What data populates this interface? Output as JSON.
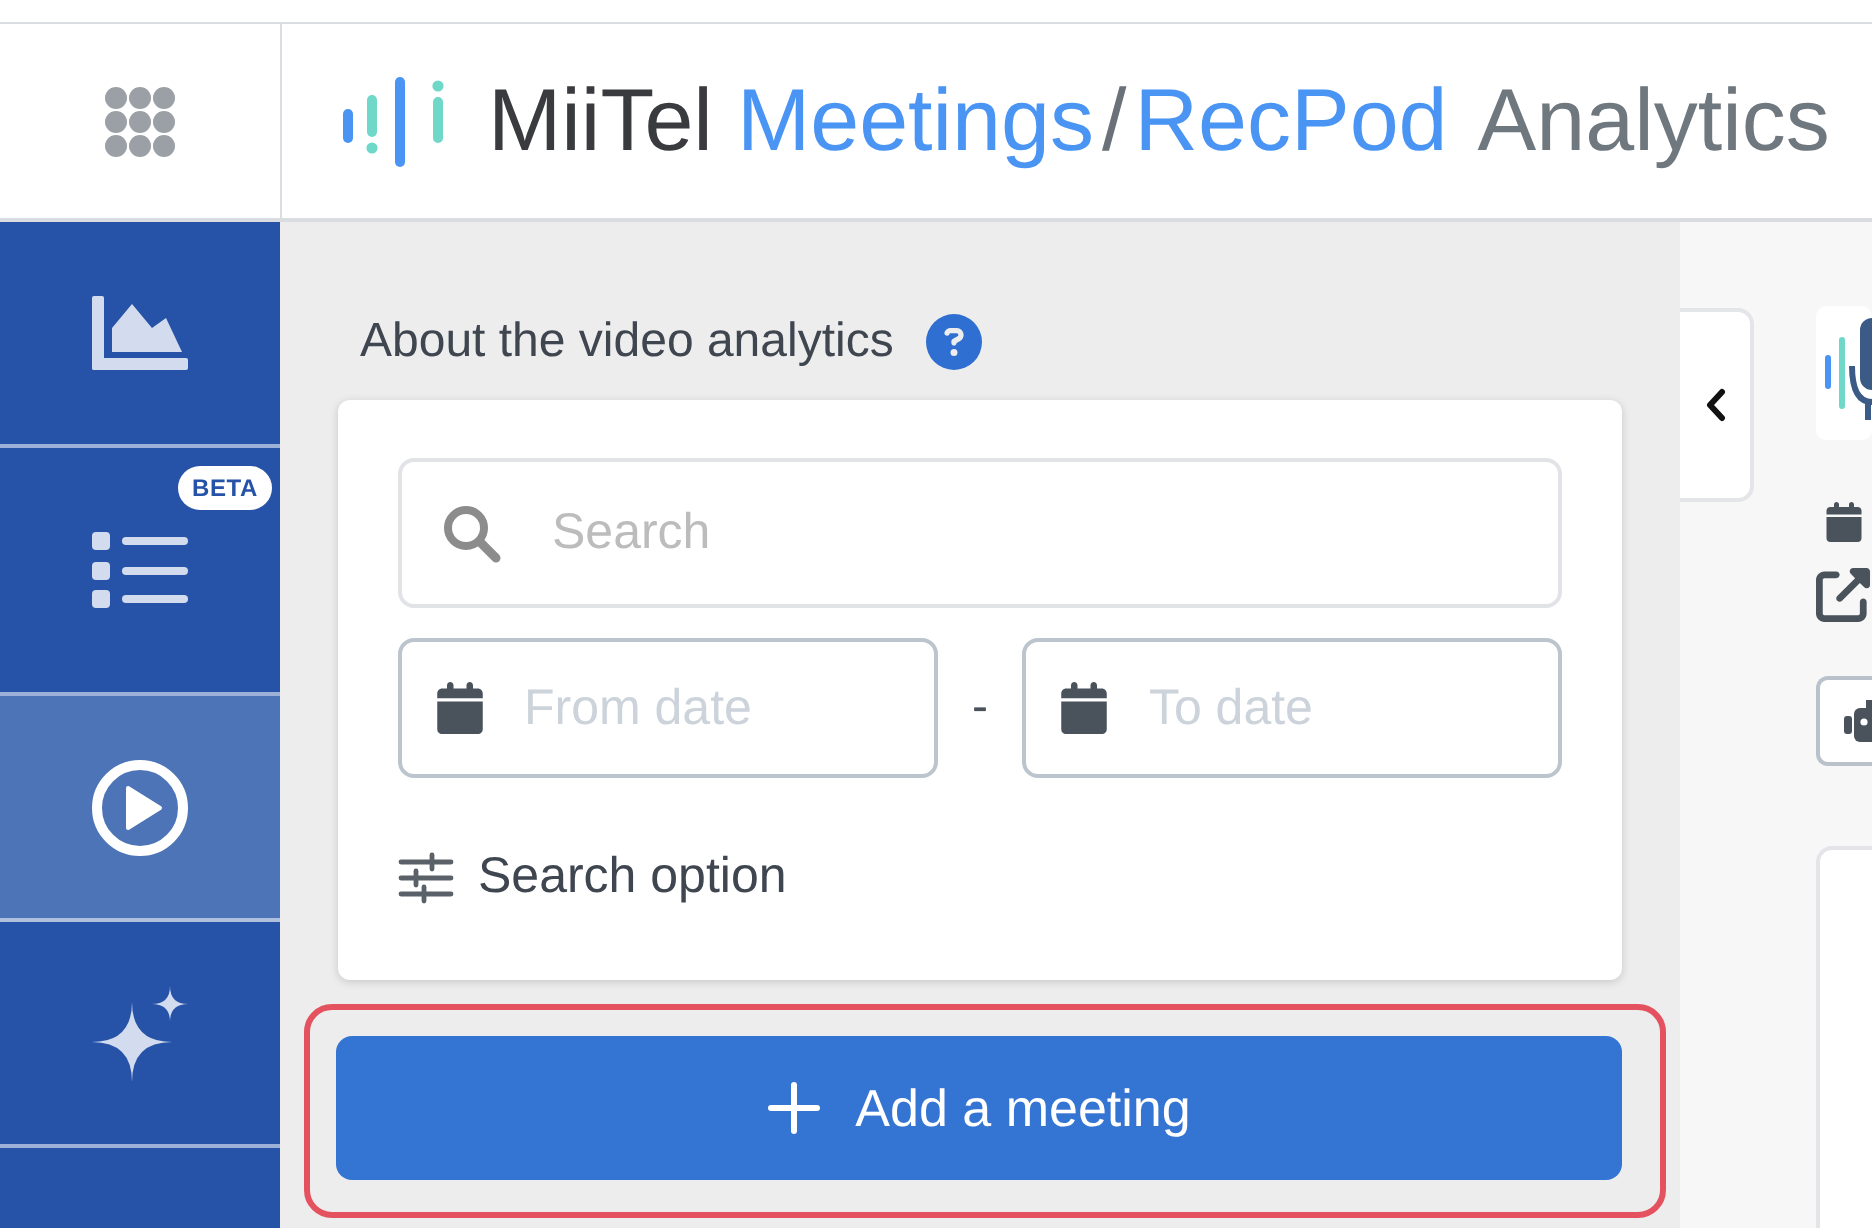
{
  "header": {
    "logo": [
      {
        "kind": "brand",
        "text": "MiiTel"
      },
      {
        "kind": "product",
        "text": "Meetings"
      },
      {
        "kind": "separator",
        "text": "/"
      },
      {
        "kind": "product",
        "text": "RecPod"
      },
      {
        "kind": "suffix",
        "text": "Analytics"
      }
    ]
  },
  "sidebar": {
    "items": [
      {
        "kind": "chart",
        "selected": false
      },
      {
        "kind": "list",
        "badge": "BETA",
        "selected": false
      },
      {
        "kind": "play",
        "selected": true
      },
      {
        "kind": "sparkle",
        "selected": false
      }
    ]
  },
  "panel": {
    "title": "About the video analytics",
    "search": {
      "placeholder": "Search"
    },
    "date_from": {
      "placeholder": "From date"
    },
    "date_separator": "-",
    "date_to": {
      "placeholder": "To date"
    },
    "search_option": "Search option",
    "add_button": {
      "label": "Add a meeting",
      "highlighted": true
    }
  }
}
